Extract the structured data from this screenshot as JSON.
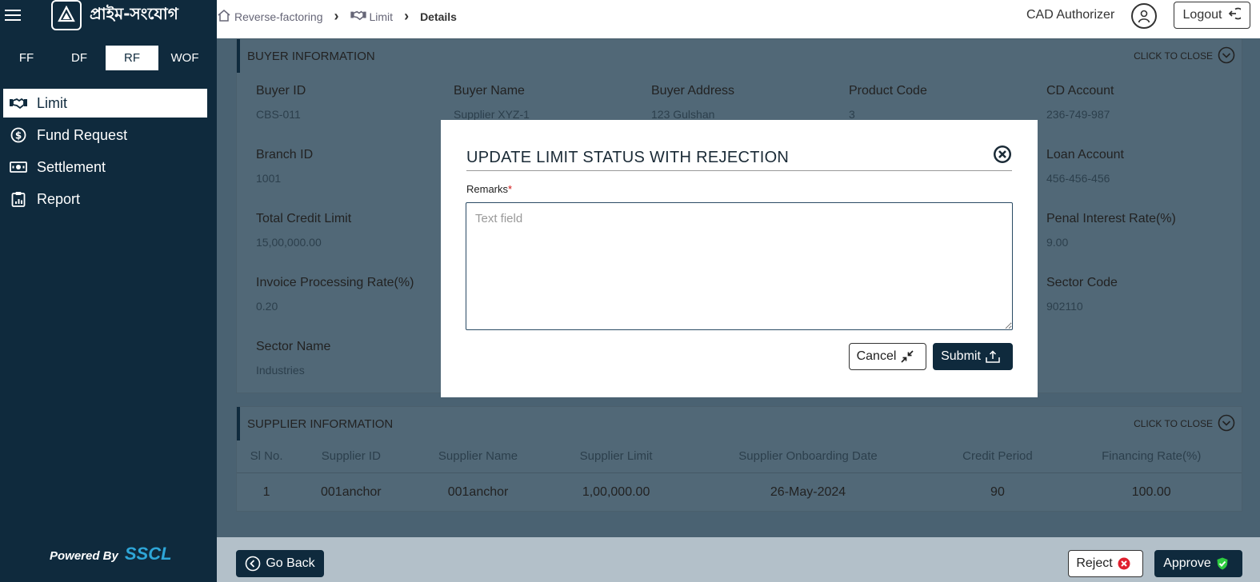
{
  "sidebar": {
    "brand_text": "প্রাইম-সংযোগ",
    "mode_tabs": [
      {
        "label": "FF"
      },
      {
        "label": "DF"
      },
      {
        "label": "RF",
        "active": true
      },
      {
        "label": "WOF"
      }
    ],
    "nav": [
      {
        "label": "Limit",
        "icon": "handshake-icon",
        "active": true
      },
      {
        "label": "Fund Request",
        "icon": "dollar-circle-icon"
      },
      {
        "label": "Settlement",
        "icon": "banknote-icon"
      },
      {
        "label": "Report",
        "icon": "clipboard-icon"
      }
    ],
    "powered_label": "Powered By",
    "powered_brand": "SSCL"
  },
  "header": {
    "breadcrumb": [
      "Reverse-factoring",
      "Limit",
      "Details"
    ],
    "user_role": "CAD Authorizer",
    "logout_label": "Logout"
  },
  "buyer": {
    "title": "BUYER INFORMATION",
    "close_label": "CLICK TO CLOSE",
    "fields": [
      {
        "label": "Buyer ID",
        "value": "CBS-011"
      },
      {
        "label": "Buyer Name",
        "value": "Supplier XYZ-1"
      },
      {
        "label": "Buyer Address",
        "value": "123 Gulshan"
      },
      {
        "label": "Product Code",
        "value": "3"
      },
      {
        "label": "CD Account",
        "value": "236-749-987"
      },
      {
        "label": "Branch ID",
        "value": "1001"
      },
      {
        "label": "",
        "value": ""
      },
      {
        "label": "",
        "value": ""
      },
      {
        "label": "",
        "value": ""
      },
      {
        "label": "Loan Account",
        "value": "456-456-456"
      },
      {
        "label": "Total Credit Limit",
        "value": "15,00,000.00"
      },
      {
        "label": "",
        "value": ""
      },
      {
        "label": "",
        "value": ""
      },
      {
        "label": "",
        "value": ""
      },
      {
        "label": "Penal Interest Rate(%)",
        "value": "9.00"
      },
      {
        "label": "Invoice Processing Rate(%)",
        "value": "0.20"
      },
      {
        "label": "",
        "value": ""
      },
      {
        "label": "",
        "value": ""
      },
      {
        "label": "",
        "value": ""
      },
      {
        "label": "Sector Code",
        "value": "902110"
      },
      {
        "label": "Sector Name",
        "value": "Industries"
      }
    ]
  },
  "supplier": {
    "title": "SUPPLIER INFORMATION",
    "close_label": "CLICK TO CLOSE",
    "columns": [
      "Sl No.",
      "Supplier ID",
      "Supplier Name",
      "Supplier Limit",
      "Supplier Onboarding Date",
      "Credit Period",
      "Financing Rate(%)"
    ],
    "rows": [
      [
        "1",
        "001anchor",
        "001anchor",
        "1,00,000.00",
        "26-May-2024",
        "90",
        "100.00"
      ]
    ]
  },
  "footer": {
    "go_back": "Go Back",
    "reject": "Reject",
    "approve": "Approve"
  },
  "modal": {
    "title": "UPDATE LIMIT STATUS WITH REJECTION",
    "remarks_label": "Remarks",
    "required_mark": "*",
    "remarks_placeholder": "Text field",
    "remarks_value": "",
    "cancel": "Cancel",
    "submit": "Submit"
  },
  "colors": {
    "sidebar_bg": "#0f2a3d",
    "overlay": "#4a6272",
    "accent_brand": "#2ea6d8",
    "reject_red": "#e0202e",
    "approve_green": "#2ecc40"
  }
}
